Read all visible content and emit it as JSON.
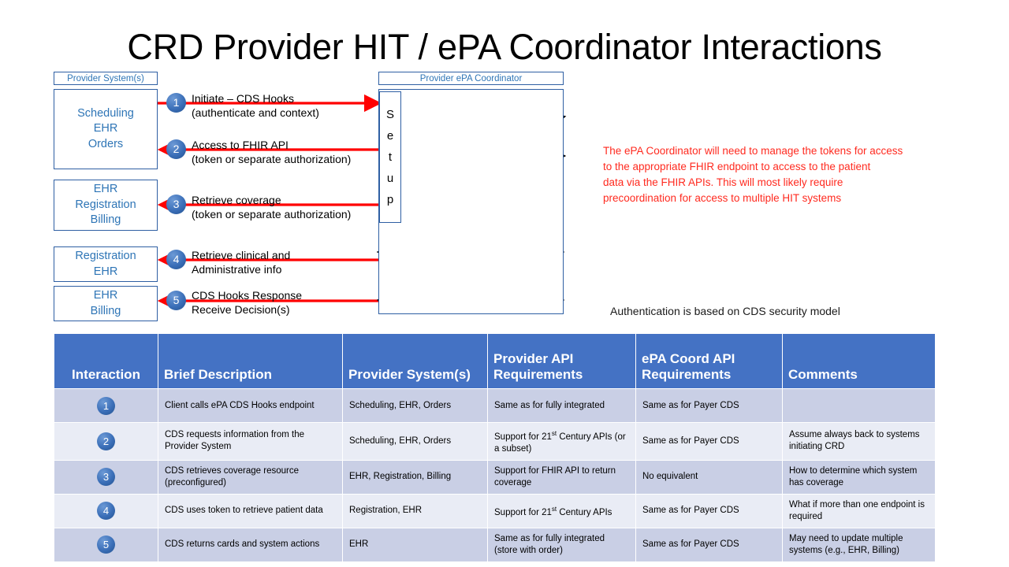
{
  "title": "CRD Provider HIT / ePA Coordinator Interactions",
  "diagram": {
    "left_lane_label": "Provider System(s)",
    "right_lane_label": "Provider ePA Coordinator",
    "setup_label": "Setup",
    "provider_boxes": [
      {
        "lines": [
          "Scheduling",
          "EHR",
          "Orders"
        ]
      },
      {
        "lines": [
          "EHR",
          "Registration",
          "Billing"
        ]
      },
      {
        "lines": [
          "Registration",
          "EHR"
        ]
      },
      {
        "lines": [
          "EHR",
          "Billing"
        ]
      }
    ],
    "interactions": [
      {
        "num": "1",
        "line1": "Initiate – CDS Hooks",
        "line2": "(authenticate and context)"
      },
      {
        "num": "2",
        "line1": "Access to FHIR API",
        "line2": "(token  or separate authorization)"
      },
      {
        "num": "3",
        "line1": "Retrieve coverage",
        "line2": "(token  or separate authorization)"
      },
      {
        "num": "4",
        "line1": "Retrieve clinical and",
        "line2": "Administrative info"
      },
      {
        "num": "5",
        "line1": "CDS Hooks  Response",
        "line2": "Receive Decision(s)"
      }
    ],
    "note_red_lines": [
      "The ePA Coordinator will need to manage the tokens  for access",
      "to  the appropriate  FHIR endpoint  to access to the patient",
      "data via the  FHIR APIs.  This will most likely require",
      "precoordination  for access to multiple  HIT systems"
    ],
    "note_black": "Authentication  is based on  CDS security model",
    "colors": {
      "accent_blue": "#2e75b6",
      "border_blue": "#2e5fa3",
      "arrow_red": "#ff0000",
      "note_red": "#ff2a1f",
      "header_blue": "#4472c4"
    }
  },
  "table": {
    "headers": [
      "Interaction",
      "Brief Description",
      "Provider System(s)",
      "Provider API Requirements",
      "ePA Coord API Requirements",
      "Comments"
    ],
    "rows": [
      {
        "num": "1",
        "description": "Client calls ePA CDS Hooks endpoint",
        "provider_systems": "Scheduling, EHR, Orders",
        "provider_api": "Same as for fully integrated",
        "provider_api_red": false,
        "epa_api": "Same as for Payer CDS",
        "epa_api_red": false,
        "comments": "",
        "comments_red": false
      },
      {
        "num": "2",
        "description": "CDS requests  information from the Provider System",
        "provider_systems": "Scheduling, EHR, Orders",
        "provider_api": "Support for 21st Century APIs (or a subset)",
        "provider_api_red": true,
        "epa_api": "Same as for Payer CDS",
        "epa_api_red": false,
        "comments": "Assume always back to systems initiating CRD",
        "comments_red": true
      },
      {
        "num": "3",
        "description": "CDS retrieves coverage resource (preconfigured)",
        "provider_systems": "EHR, Registration, Billing",
        "provider_api": "Support for FHIR API to return coverage",
        "provider_api_red": true,
        "epa_api": "No equivalent",
        "epa_api_red": true,
        "comments": "How to determine  which system has coverage",
        "comments_red": true
      },
      {
        "num": "4",
        "description": "CDS uses token  to retrieve patient data",
        "provider_systems": "Registration, EHR",
        "provider_api": "Support for 21st Century APIs",
        "provider_api_red": false,
        "epa_api": "Same as for Payer CDS",
        "epa_api_red": false,
        "comments": "What if more than one endpoint is required",
        "comments_red": true
      },
      {
        "num": "5",
        "description": "CDS returns cards and system actions",
        "provider_systems": "EHR",
        "provider_api": "Same as for fully integrated (store with order)",
        "provider_api_red": true,
        "epa_api": "Same as for Payer CDS",
        "epa_api_red": false,
        "comments": "May  need to update multiple systems (e.g.,  EHR,  Billing)",
        "comments_red": true
      }
    ]
  }
}
